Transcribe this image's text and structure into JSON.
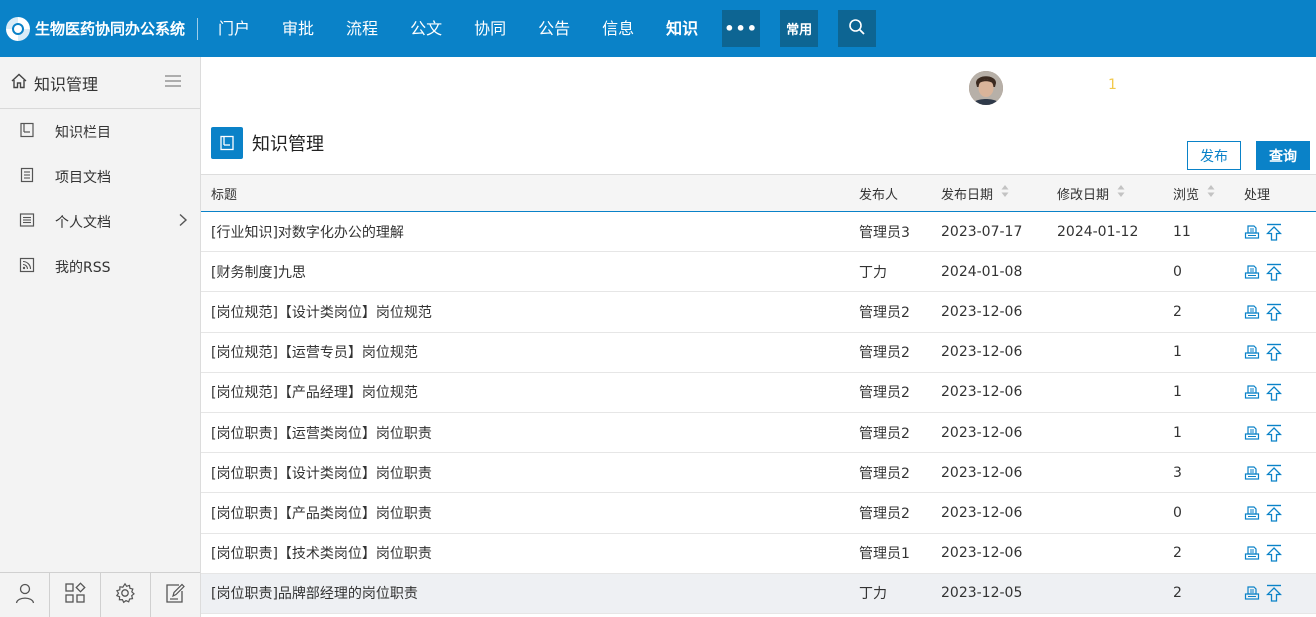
{
  "app": {
    "title": "生物医药协同办公系统"
  },
  "nav": {
    "items": [
      "门户",
      "审批",
      "流程",
      "公文",
      "协同",
      "公告",
      "信息",
      "知识"
    ],
    "active_index": 7,
    "more_label": "•••",
    "common_label": "常用"
  },
  "sidebar": {
    "title": "知识管理",
    "items": [
      {
        "label": "知识栏目",
        "icon": "column-icon"
      },
      {
        "label": "项目文档",
        "icon": "document-icon"
      },
      {
        "label": "个人文档",
        "icon": "list-icon",
        "has_children": true
      },
      {
        "label": "我的RSS",
        "icon": "rss-icon"
      }
    ]
  },
  "header": {
    "notice_count": "1"
  },
  "page": {
    "title": "知识管理",
    "publish_label": "发布",
    "query_label": "查询"
  },
  "table": {
    "columns": [
      "标题",
      "发布人",
      "发布日期",
      "修改日期",
      "浏览",
      "处理"
    ],
    "rows": [
      {
        "title": "[行业知识]对数字化办公的理解",
        "publisher": "管理员3",
        "pub_date": "2023-07-17",
        "mod_date": "2024-01-12",
        "views": "11"
      },
      {
        "title": "[财务制度]九思",
        "publisher": "丁力",
        "pub_date": "2024-01-08",
        "mod_date": "",
        "views": "0"
      },
      {
        "title": "[岗位规范]【设计类岗位】岗位规范",
        "publisher": "管理员2",
        "pub_date": "2023-12-06",
        "mod_date": "",
        "views": "2"
      },
      {
        "title": "[岗位规范]【运营专员】岗位规范",
        "publisher": "管理员2",
        "pub_date": "2023-12-06",
        "mod_date": "",
        "views": "1"
      },
      {
        "title": "[岗位规范]【产品经理】岗位规范",
        "publisher": "管理员2",
        "pub_date": "2023-12-06",
        "mod_date": "",
        "views": "1"
      },
      {
        "title": "[岗位职责]【运营类岗位】岗位职责",
        "publisher": "管理员2",
        "pub_date": "2023-12-06",
        "mod_date": "",
        "views": "1"
      },
      {
        "title": "[岗位职责]【设计类岗位】岗位职责",
        "publisher": "管理员2",
        "pub_date": "2023-12-06",
        "mod_date": "",
        "views": "3"
      },
      {
        "title": "[岗位职责]【产品类岗位】岗位职责",
        "publisher": "管理员2",
        "pub_date": "2023-12-06",
        "mod_date": "",
        "views": "0"
      },
      {
        "title": "[岗位职责]【技术类岗位】岗位职责",
        "publisher": "管理员1",
        "pub_date": "2023-12-06",
        "mod_date": "",
        "views": "2"
      },
      {
        "title": "[岗位职责]品牌部经理的岗位职责",
        "publisher": "丁力",
        "pub_date": "2023-12-05",
        "mod_date": "",
        "views": "2"
      }
    ]
  },
  "colors": {
    "primary": "#0a82c8",
    "nav_button": "#0d6593",
    "notice": "#f2c94c"
  }
}
